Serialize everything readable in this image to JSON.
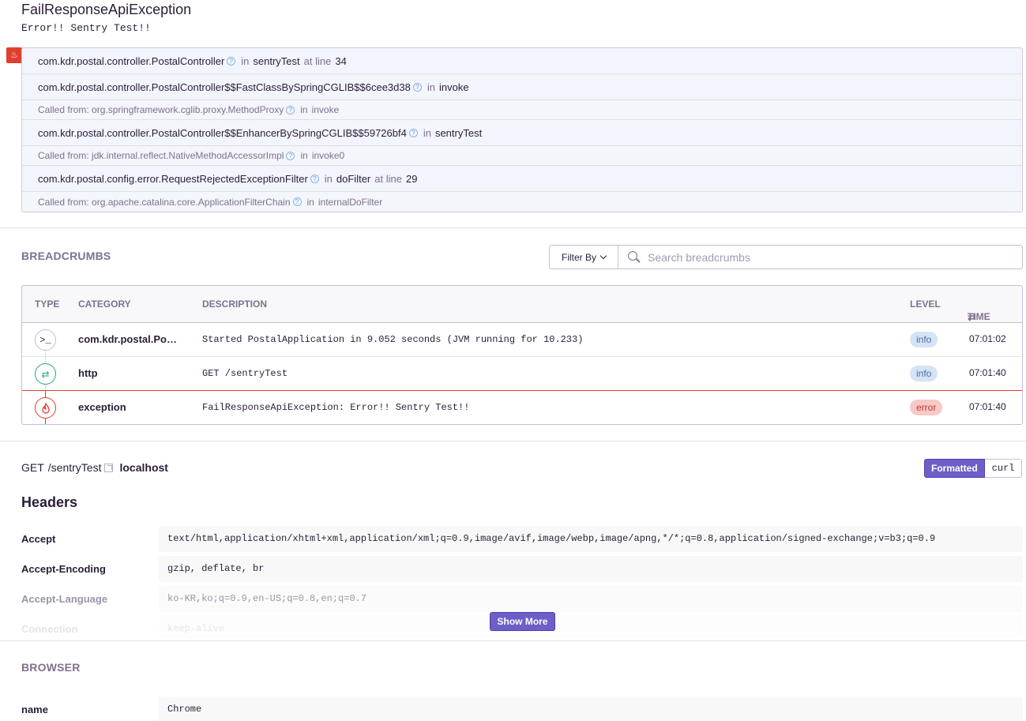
{
  "exception": {
    "type": "FailResponseApiException",
    "message": "Error!! Sentry Test!!"
  },
  "platform_icon": "java-icon",
  "stack_frames": [
    {
      "kind": "frame",
      "module": "com.kdr.postal.controller.PostalController",
      "in": "in",
      "function": "sentryTest",
      "at_line_label": "at line",
      "line": "34"
    },
    {
      "kind": "frame",
      "module": "com.kdr.postal.controller.PostalController$$FastClassBySpringCGLIB$$6cee3d38",
      "in": "in",
      "function": "invoke",
      "at_line_label": "",
      "line": ""
    },
    {
      "kind": "called",
      "prefix": "Called from: ",
      "module": "org.springframework.cglib.proxy.MethodProxy",
      "in": "in",
      "function": "invoke"
    },
    {
      "kind": "frame",
      "module": "com.kdr.postal.controller.PostalController$$EnhancerBySpringCGLIB$$59726bf4",
      "in": "in",
      "function": "sentryTest",
      "at_line_label": "",
      "line": ""
    },
    {
      "kind": "called",
      "prefix": "Called from: ",
      "module": "jdk.internal.reflect.NativeMethodAccessorImpl",
      "in": "in",
      "function": "invoke0"
    },
    {
      "kind": "frame",
      "module": "com.kdr.postal.config.error.RequestRejectedExceptionFilter",
      "in": "in",
      "function": "doFilter",
      "at_line_label": "at line",
      "line": "29"
    },
    {
      "kind": "called",
      "prefix": "Called from: ",
      "module": "org.apache.catalina.core.ApplicationFilterChain",
      "in": "in",
      "function": "internalDoFilter"
    }
  ],
  "breadcrumbs": {
    "title": "BREADCRUMBS",
    "filter_label": "Filter By",
    "search_placeholder": "Search breadcrumbs",
    "columns": {
      "type": "TYPE",
      "category": "CATEGORY",
      "description": "DESCRIPTION",
      "level": "LEVEL",
      "time": "TIME"
    },
    "rows": [
      {
        "icon": "terminal-icon",
        "category": "com.kdr.postal.PostalApplication",
        "description": "Started PostalApplication in 9.052 seconds (JVM running for 10.233)",
        "level": "info",
        "time": "07:01:02"
      },
      {
        "icon": "http-swap-icon",
        "category": "http",
        "description": "GET /sentryTest",
        "level": "info",
        "time": "07:01:40"
      },
      {
        "icon": "fire-icon",
        "category": "exception",
        "description": "FailResponseApiException: Error!! Sentry Test!!",
        "level": "error",
        "time": "07:01:40"
      }
    ]
  },
  "request": {
    "method": "GET",
    "path": "/sentryTest",
    "host": "localhost",
    "formatted_label": "Formatted",
    "curl_label": "curl",
    "headers_title": "Headers",
    "headers": [
      {
        "key": "Accept",
        "value": "text/html,application/xhtml+xml,application/xml;q=0.9,image/avif,image/webp,image/apng,*/*;q=0.8,application/signed-exchange;v=b3;q=0.9"
      },
      {
        "key": "Accept-Encoding",
        "value": "gzip, deflate, br"
      },
      {
        "key": "Accept-Language",
        "value": "ko-KR,ko;q=0.9,en-US;q=0.8,en;q=0.7"
      },
      {
        "key": "Connection",
        "value": "keep-alive"
      }
    ],
    "show_more_label": "Show More"
  },
  "browser": {
    "title": "BROWSER",
    "rows": [
      {
        "key": "name",
        "value": "Chrome"
      }
    ]
  },
  "colors": {
    "accent": "#6c5fc7",
    "error": "#e03e2f",
    "http": "#2ba185"
  }
}
